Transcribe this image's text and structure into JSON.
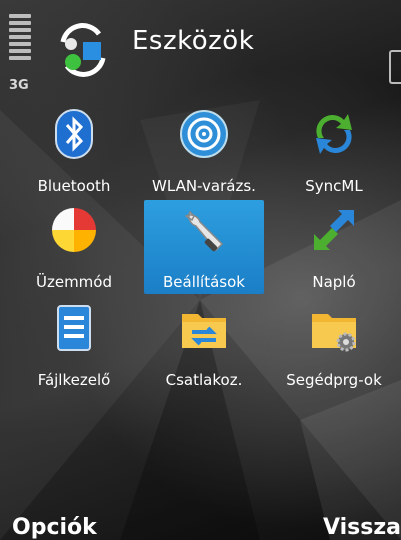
{
  "status": {
    "network": "3G"
  },
  "header": {
    "title": "Eszközök"
  },
  "apps": [
    {
      "label": "Bluetooth",
      "icon": "bluetooth-icon"
    },
    {
      "label": "WLAN-varázs.",
      "icon": "wlan-wizard-icon"
    },
    {
      "label": "SyncML",
      "icon": "sync-icon"
    },
    {
      "label": "Üzemmód",
      "icon": "profiles-icon"
    },
    {
      "label": "Beállítások",
      "icon": "wrench-settings-icon",
      "selected": true
    },
    {
      "label": "Napló",
      "icon": "log-arrows-icon"
    },
    {
      "label": "Fájlkezelő",
      "icon": "file-manager-icon"
    },
    {
      "label": "Csatlakoz.",
      "icon": "connectivity-folder-icon"
    },
    {
      "label": "Segédprg-ok",
      "icon": "utilities-folder-icon"
    }
  ],
  "softkeys": {
    "left": "Opciók",
    "right": "Vissza"
  },
  "colors": {
    "selection": "#2196d8",
    "text": "#ffffff"
  }
}
